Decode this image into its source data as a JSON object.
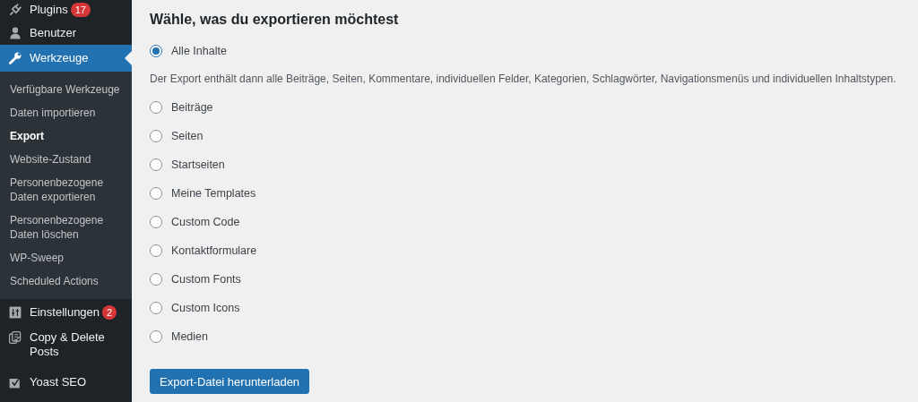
{
  "sidebar": {
    "items_top": [
      {
        "label": "Plugins",
        "badge": "17",
        "selected": false
      },
      {
        "label": "Benutzer",
        "selected": false
      },
      {
        "label": "Werkzeuge",
        "selected": true
      }
    ],
    "submenu": [
      {
        "label": "Verfügbare Werkzeuge",
        "selected": false
      },
      {
        "label": "Daten importieren",
        "selected": false
      },
      {
        "label": "Export",
        "selected": true
      },
      {
        "label": "Website-Zustand",
        "selected": false
      },
      {
        "label": "Personenbezogene Daten exportieren",
        "selected": false
      },
      {
        "label": "Personenbezogene Daten löschen",
        "selected": false
      },
      {
        "label": "WP-Sweep",
        "selected": false
      },
      {
        "label": "Scheduled Actions",
        "selected": false
      }
    ],
    "items_bottom": [
      {
        "label": "Einstellungen",
        "badge": "2",
        "selected": false
      },
      {
        "label": "Copy & Delete Posts",
        "selected": false
      },
      {
        "label": "Yoast SEO",
        "selected": false
      }
    ]
  },
  "main": {
    "heading": "Wähle, was du exportieren möchtest",
    "options": [
      {
        "label": "Alle Inhalte",
        "selected": true,
        "description": "Der Export enthält dann alle Beiträge, Seiten, Kommentare, individuellen Felder, Kategorien, Schlagwörter, Navigationsmenüs und individuellen Inhaltstypen."
      },
      {
        "label": "Beiträge",
        "selected": false
      },
      {
        "label": "Seiten",
        "selected": false
      },
      {
        "label": "Startseiten",
        "selected": false
      },
      {
        "label": "Meine Templates",
        "selected": false
      },
      {
        "label": "Custom Code",
        "selected": false
      },
      {
        "label": "Kontaktformulare",
        "selected": false
      },
      {
        "label": "Custom Fonts",
        "selected": false
      },
      {
        "label": "Custom Icons",
        "selected": false
      },
      {
        "label": "Medien",
        "selected": false
      }
    ],
    "button": "Export-Datei herunterladen"
  }
}
